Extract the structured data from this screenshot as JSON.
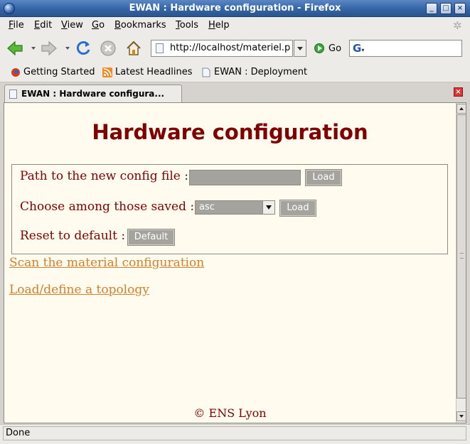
{
  "window": {
    "title": "EWAN : Hardware configuration - Firefox",
    "controls": {
      "minimize": "_",
      "maximize": "□",
      "close": "×"
    }
  },
  "menubar": {
    "items": [
      {
        "label": "File",
        "accel": "F",
        "rest": "ile"
      },
      {
        "label": "Edit",
        "accel": "E",
        "rest": "dit"
      },
      {
        "label": "View",
        "accel": "V",
        "rest": "iew"
      },
      {
        "label": "Go",
        "accel": "G",
        "rest": "o"
      },
      {
        "label": "Bookmarks",
        "accel": "B",
        "rest": "ookmarks"
      },
      {
        "label": "Tools",
        "accel": "T",
        "rest": "ools"
      },
      {
        "label": "Help",
        "accel": "H",
        "rest": "elp"
      }
    ]
  },
  "navbar": {
    "url": "http://localhost/materiel.p",
    "go_label": "Go",
    "search_value": ""
  },
  "bookmarks": {
    "items": [
      {
        "label": "Getting Started",
        "icon": "firefox-icon"
      },
      {
        "label": "Latest Headlines",
        "icon": "rss-feed-icon"
      },
      {
        "label": "EWAN : Deployment",
        "icon": "page-icon"
      }
    ]
  },
  "tabs": [
    {
      "label": "EWAN : Hardware configura...",
      "active": true
    }
  ],
  "page": {
    "title": "Hardware configuration",
    "config_rows": {
      "path_label": "Path to the new config file :",
      "path_value": "",
      "path_button": "Load",
      "choose_label": "Choose among those saved :",
      "choose_selected": "asc",
      "choose_button": "Load",
      "reset_label": "Reset to default :",
      "reset_button": "Default"
    },
    "links": [
      "Scan the material configuration",
      "Load/define a topology"
    ],
    "footer": "© ENS Lyon"
  },
  "status": {
    "text": "Done"
  },
  "colors": {
    "heading": "#800000",
    "link": "#d2802a",
    "page_background": "#fffbef",
    "control_gray": "#a5a39d"
  }
}
